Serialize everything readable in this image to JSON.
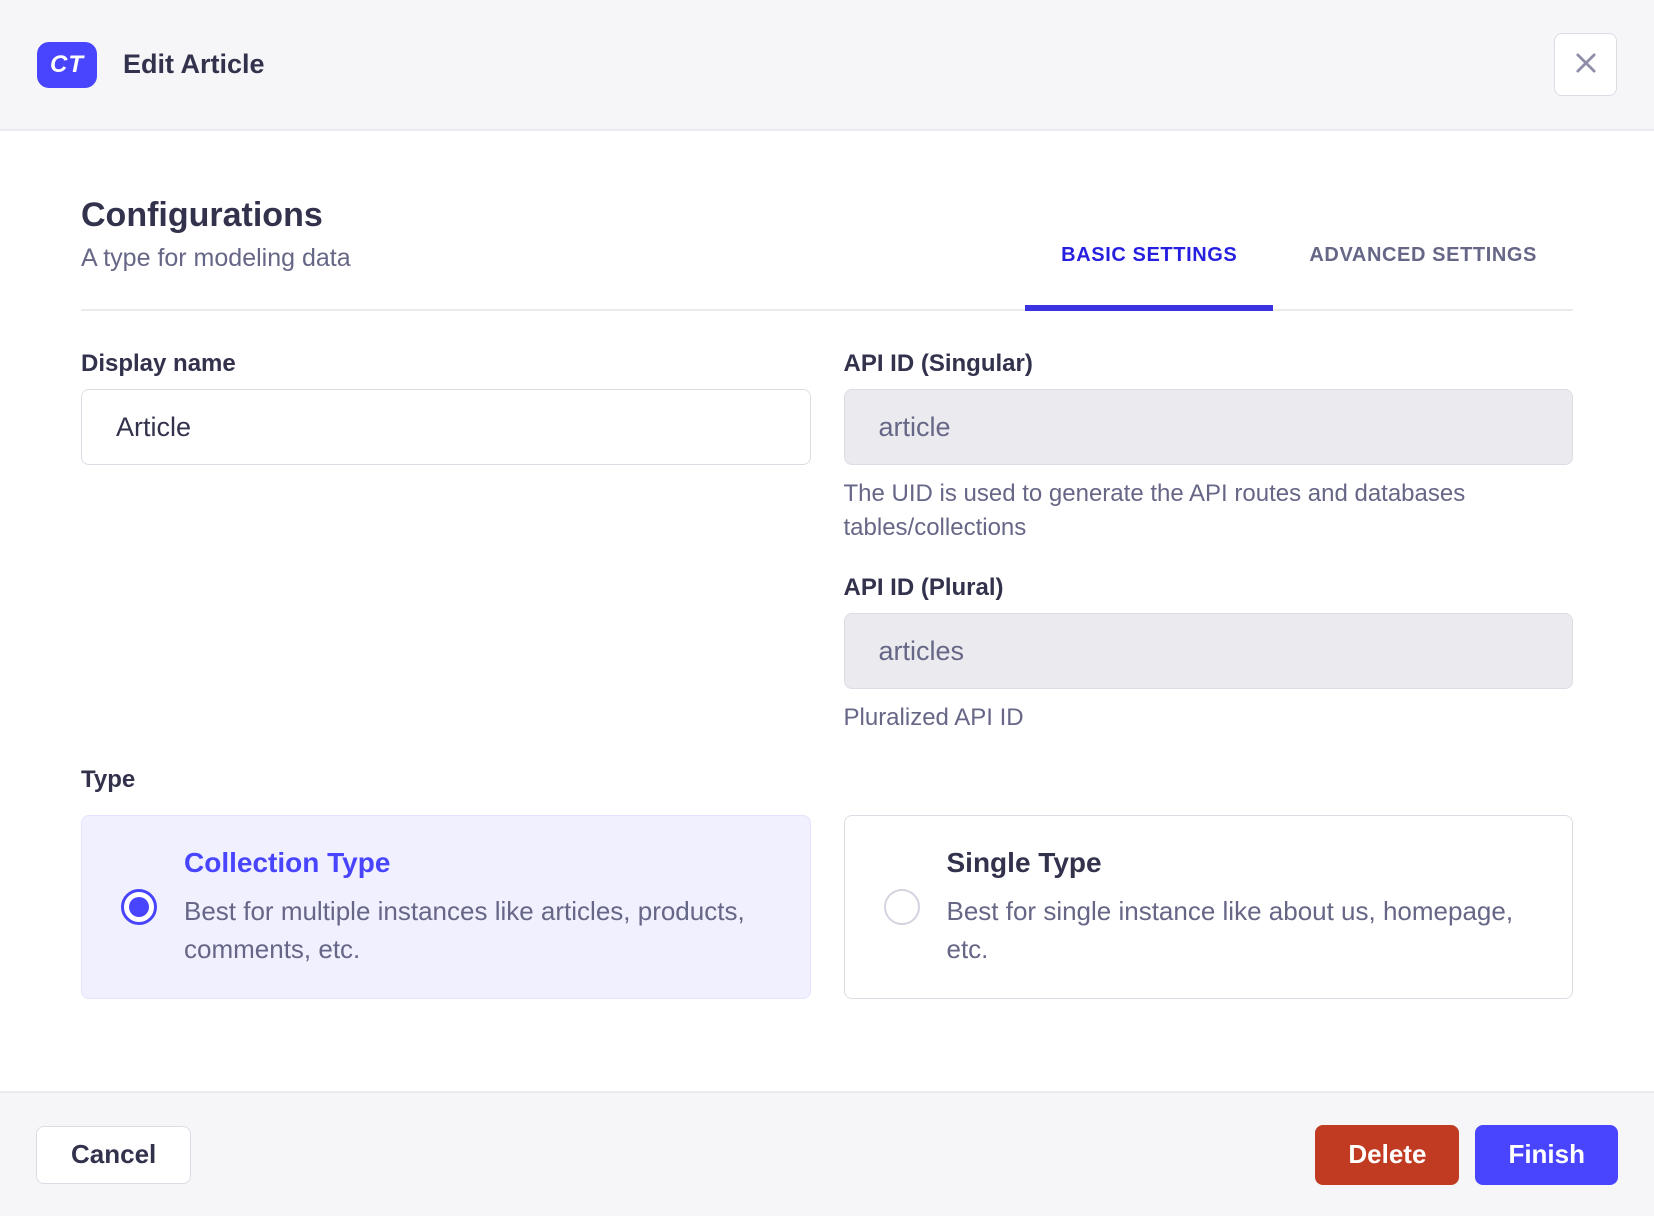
{
  "header": {
    "badge": "CT",
    "title": "Edit Article"
  },
  "section": {
    "title": "Configurations",
    "subtitle": "A type for modeling data"
  },
  "tabs": [
    {
      "label": "BASIC SETTINGS",
      "active": true
    },
    {
      "label": "ADVANCED SETTINGS",
      "active": false
    }
  ],
  "form": {
    "display_name": {
      "label": "Display name",
      "value": "Article"
    },
    "api_id_singular": {
      "label": "API ID (Singular)",
      "value": "article",
      "disabled": true,
      "hint": "The UID is used to generate the API routes and databases tables/collections"
    },
    "api_id_plural": {
      "label": "API ID (Plural)",
      "value": "articles",
      "disabled": true,
      "hint": "Pluralized API ID"
    },
    "type": {
      "label": "Type",
      "options": [
        {
          "title": "Collection Type",
          "description": "Best for multiple instances like articles, products, comments, etc.",
          "selected": true
        },
        {
          "title": "Single Type",
          "description": "Best for single instance like about us, homepage, etc.",
          "selected": false
        }
      ]
    }
  },
  "footer": {
    "cancel_label": "Cancel",
    "delete_label": "Delete",
    "finish_label": "Finish"
  },
  "colors": {
    "primary": "#4945ff",
    "primary_dark": "#271fe0",
    "danger": "#c13a22",
    "surface_gray": "#f6f6f9",
    "border_gray": "#dcdce4",
    "divider": "#eaeaef",
    "text_dark": "#32324d",
    "text_muted": "#666687",
    "selected_card_bg": "#f0f0ff",
    "disabled_input_bg": "#eaeaef"
  }
}
